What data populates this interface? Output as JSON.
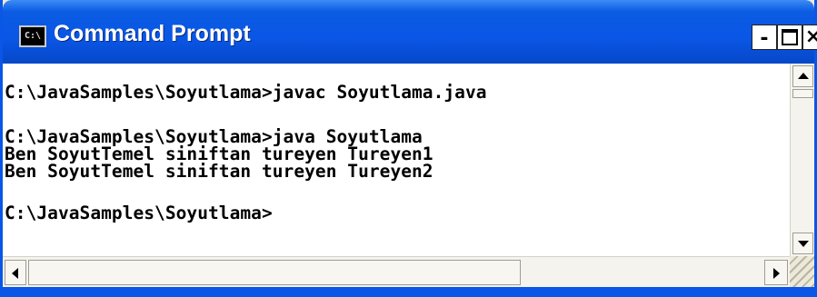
{
  "window": {
    "title": "Command Prompt",
    "icon_text": "C:\\",
    "controls": {
      "minimize": "-",
      "maximize": "maximize",
      "close": "×"
    }
  },
  "console": {
    "lines": [
      "C:\\JavaSamples\\Soyutlama>javac Soyutlama.java",
      "",
      "C:\\JavaSamples\\Soyutlama>java Soyutlama",
      "Ben SoyutTemel siniftan tureyen Tureyen1",
      "Ben SoyutTemel siniftan tureyen Tureyen2",
      "",
      "C:\\JavaSamples\\Soyutlama>"
    ]
  },
  "colors": {
    "titlebar": "#0a56e6",
    "console_bg": "#ffffff",
    "console_text": "#000000",
    "scrollbar": "#f4f3ee"
  },
  "icons": [
    "cmd-icon",
    "minimize-icon",
    "maximize-icon",
    "close-icon",
    "scroll-up-icon",
    "scroll-down-icon",
    "scroll-left-icon",
    "scroll-right-icon",
    "resize-grip-icon"
  ]
}
